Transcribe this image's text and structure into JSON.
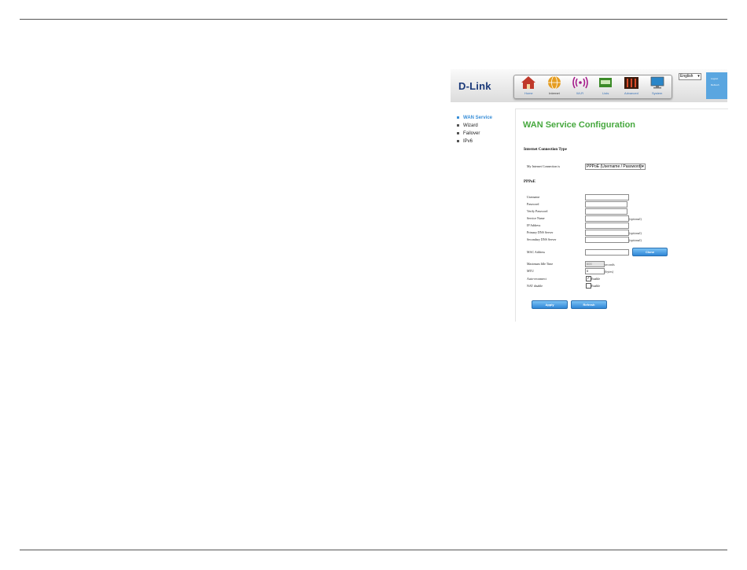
{
  "language": "English",
  "user_panel": {
    "line1": "Logout",
    "line2": "Refresh"
  },
  "logo": "D-Link",
  "nav": [
    {
      "label": "Home",
      "icon": "home-icon",
      "color": "#c0392b"
    },
    {
      "label": "Internet",
      "icon": "globe-icon",
      "color": "#e59d21"
    },
    {
      "label": "Wi-Fi",
      "icon": "wifi-icon",
      "color": "#a51c8a"
    },
    {
      "label": "Lists",
      "icon": "lan-icon",
      "color": "#3b8a28"
    },
    {
      "label": "Advanced",
      "icon": "advanced-icon",
      "color": "#7a2b10"
    },
    {
      "label": "System",
      "icon": "monitor-icon",
      "color": "#2a86c8"
    }
  ],
  "sidebar": [
    {
      "label": "WAN Service",
      "active": true
    },
    {
      "label": "Wizard",
      "active": false
    },
    {
      "label": "Failover",
      "active": false
    },
    {
      "label": "IPv6",
      "active": false
    }
  ],
  "page": {
    "title": "WAN Service Configuration",
    "section_connection": "Internet Connection Type",
    "connection_label": "My Internet Connection is",
    "connection_value": "PPPoE (Username / Password)",
    "section_pppoe": "PPPoE",
    "fields": {
      "username": "Username",
      "password": "Password",
      "verify_password": "Verify Password",
      "service_name": "Service Name",
      "ip_address": "IP Address",
      "primary_dns": "Primary DNS Server",
      "secondary_dns": "Secondary DNS Server",
      "mac_address": "MAC Address",
      "max_idle": "Maximum Idle Time",
      "mtu": "MTU",
      "auto_reconnect": "Auto-reconnect",
      "nat_disable": "NAT disable"
    },
    "optional_hint": "(optional)",
    "seconds_hint": "seconds",
    "bytes_hint": "(bytes)",
    "max_idle_value": "600",
    "mtu_value": "0",
    "enable_label": "Enable",
    "clone_button": "Clone",
    "apply_button": "Apply",
    "refresh_button": "Refresh",
    "auto_reconnect_checked": true,
    "nat_disable_checked": false
  }
}
